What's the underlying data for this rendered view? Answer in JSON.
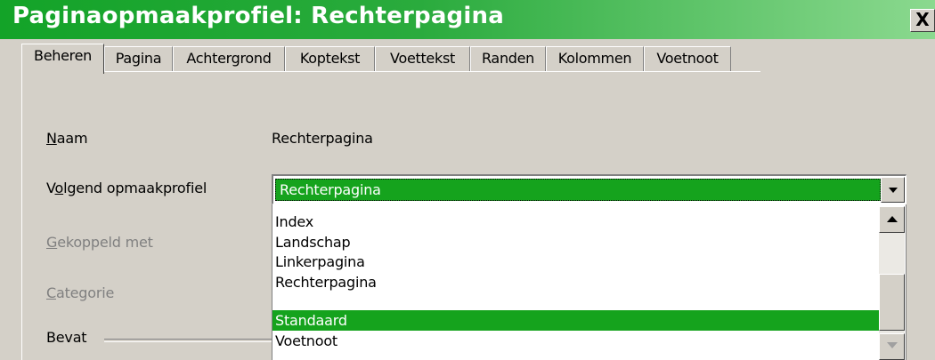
{
  "dialog": {
    "title": "Paginaopmaakprofiel: Rechterpagina",
    "close_label": "X"
  },
  "tabs": [
    {
      "label": "Beheren",
      "active": true
    },
    {
      "label": "Pagina"
    },
    {
      "label": "Achtergrond"
    },
    {
      "label": "Koptekst"
    },
    {
      "label": "Voettekst"
    },
    {
      "label": "Randen"
    },
    {
      "label": "Kolommen"
    },
    {
      "label": "Voetnoot"
    }
  ],
  "form": {
    "naam": {
      "hotkey": "N",
      "rest": "aam",
      "value": "Rechterpagina"
    },
    "volgend": {
      "pre": "V",
      "hotkey": "o",
      "rest": "lgend opmaakprofiel",
      "value": "Rechterpagina"
    },
    "gekoppeld": {
      "hotkey": "G",
      "rest": "ekoppeld met"
    },
    "categorie": {
      "hotkey": "C",
      "rest": "ategorie"
    },
    "bevat": "Bevat"
  },
  "dropdown": {
    "items": [
      "Index",
      "Landschap",
      "Linkerpagina",
      "Rechterpagina",
      "Standaard",
      "Voetnoot"
    ],
    "selected": "Standaard"
  },
  "colors": {
    "title_gradient_start": "#13a328",
    "title_gradient_end": "#8bd98f",
    "selection": "#15a31d",
    "dialog_bg": "#d4d0c8"
  }
}
